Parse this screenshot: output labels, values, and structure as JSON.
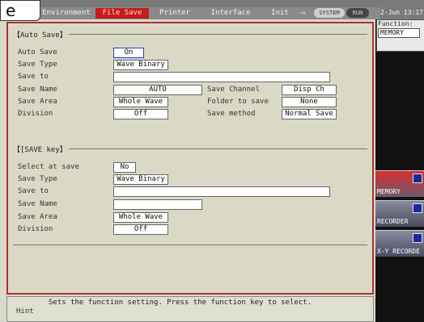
{
  "screen_title": "e",
  "tabs": [
    {
      "label": "Environment",
      "active": false
    },
    {
      "label": "File Save",
      "active": true
    },
    {
      "label": "Printer",
      "active": false
    },
    {
      "label": "Interface",
      "active": false
    },
    {
      "label": "Init",
      "active": false
    }
  ],
  "status": {
    "system_icon": "SYSTEM",
    "run_icon": "RUN",
    "datetime": "2-Jun 13:17:1"
  },
  "function_panel": {
    "label": "Function:",
    "value": "MEMORY",
    "keys": [
      {
        "label": "MEMORY",
        "icon": "memory-icon"
      },
      {
        "label": "RECORDER",
        "icon": "recorder-icon"
      },
      {
        "label": "X-Y RECORDE",
        "icon": "xy-recorder-icon"
      }
    ]
  },
  "auto_save": {
    "title": "【Auto Save】",
    "labels": {
      "auto_save": "Auto Save",
      "save_type": "Save Type",
      "save_to": "Save to",
      "save_name": "Save Name",
      "save_area": "Save Area",
      "division": "Division",
      "save_channel": "Save Channel",
      "folder_to_save": "Folder to save",
      "save_method": "Save method"
    },
    "values": {
      "auto_save": "On",
      "save_type": "Wave Binary",
      "save_to": "",
      "save_name": "AUTO",
      "save_area": "Whole Wave",
      "division": "Off",
      "save_channel": "Disp Ch",
      "folder_to_save": "None",
      "save_method": "Normal Save"
    }
  },
  "save_key": {
    "title": "【[SAVE key】",
    "labels": {
      "select_at_save": "Select at save",
      "save_type": "Save Type",
      "save_to": "Save to",
      "save_name": "Save Name",
      "save_area": "Save Area",
      "division": "Division"
    },
    "values": {
      "select_at_save": "No",
      "save_type": "Wave Binary",
      "save_to": "",
      "save_name": "",
      "save_area": "Whole Wave",
      "division": "Off"
    }
  },
  "hint": {
    "label": "Hint",
    "text": "Sets the function setting.  Press the function key to select."
  },
  "colors": {
    "active_tab": "#c81b1b",
    "panel_border": "#b03030",
    "selected_field_border": "#2a3ad0"
  }
}
